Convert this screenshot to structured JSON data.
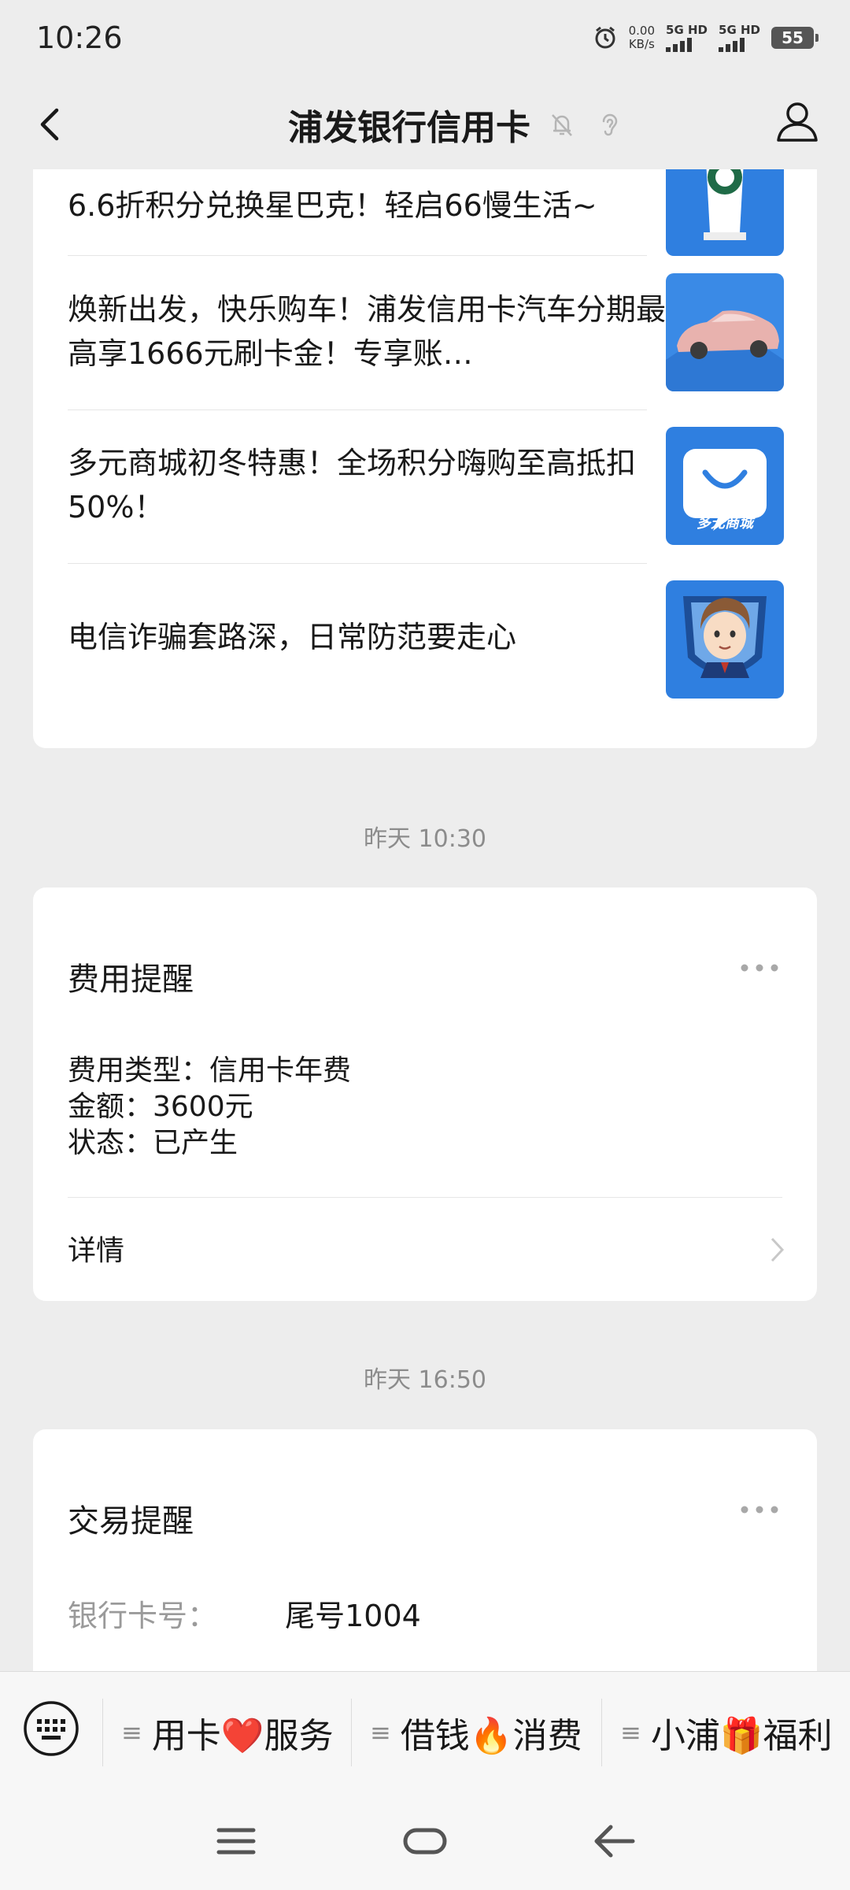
{
  "status_bar": {
    "time": "10:26",
    "net_speed_value": "0.00",
    "net_speed_unit": "KB/s",
    "signal1_label": "5G HD",
    "signal2_label": "5G HD",
    "battery": "55"
  },
  "nav": {
    "title": "浦发银行信用卡"
  },
  "articles": [
    {
      "title": "6.6折积分兑换星巴克！轻启66慢生活~",
      "thumb_icon": "starbucks-cup-icon"
    },
    {
      "title": "焕新出发，快乐购车！浦发信用卡汽车分期最高享1666元刷卡金！专享账…",
      "thumb_icon": "car-icon"
    },
    {
      "title": "多元商城初冬特惠！全场积分嗨购至高抵扣50%！",
      "thumb_icon": "mall-bag-icon",
      "thumb_text": "多元商城"
    },
    {
      "title": "电信诈骗套路深，日常防范要走心",
      "thumb_icon": "police-avatar-icon"
    }
  ],
  "timestamp1": "昨天 10:30",
  "fee_notice": {
    "title": "费用提醒",
    "line1": "费用类型：信用卡年费",
    "line2": "金额：3600元",
    "line3": "状态：已产生",
    "detail": "详情"
  },
  "timestamp2": "昨天 16:50",
  "txn_notice": {
    "title": "交易提醒",
    "card_label": "银行卡号：",
    "card_value": "尾号1004"
  },
  "menu": {
    "item1": "用卡❤️服务",
    "item2": "借钱🔥消费",
    "item3": "小浦🎁福利"
  },
  "colors": {
    "background": "#ededed",
    "card": "#ffffff",
    "thumb_blue": "#2f7fe0",
    "secondary_text": "#8c8c8c"
  }
}
